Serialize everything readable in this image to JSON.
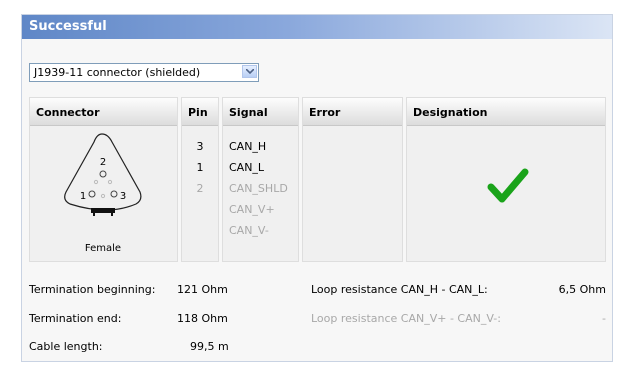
{
  "header": {
    "title": "Successful"
  },
  "connector_select": {
    "value": "J1939-11 connector (shielded)"
  },
  "table": {
    "columns": {
      "connector": "Connector",
      "pin": "Pin",
      "signal": "Signal",
      "error": "Error",
      "designation": "Designation"
    },
    "connector_caption": "Female",
    "diagram_pins": [
      "1",
      "2",
      "3"
    ],
    "rows": [
      {
        "pin": "3",
        "signal": "CAN_H",
        "active": true
      },
      {
        "pin": "1",
        "signal": "CAN_L",
        "active": true
      },
      {
        "pin": "2",
        "signal": "CAN_SHLD",
        "active": false
      },
      {
        "pin": "",
        "signal": "CAN_V+",
        "active": false
      },
      {
        "pin": "",
        "signal": "CAN_V-",
        "active": false
      }
    ],
    "designation_icon": "green-checkmark-icon"
  },
  "measurements": {
    "termination_beginning": {
      "label": "Termination beginning:",
      "value": "121 Ohm"
    },
    "termination_end": {
      "label": "Termination end:",
      "value": "118 Ohm"
    },
    "cable_length": {
      "label": "Cable length:",
      "value": "99,5 m"
    },
    "loop_canh_canl": {
      "label": "Loop resistance CAN_H - CAN_L:",
      "value": "6,5 Ohm"
    },
    "loop_canv": {
      "label": "Loop resistance CAN_V+ - CAN_V-:",
      "value": "-"
    }
  },
  "colors": {
    "header_accent": "#5f87c7",
    "check": "#1aa31a",
    "disabled_text": "#a8a8a8"
  }
}
